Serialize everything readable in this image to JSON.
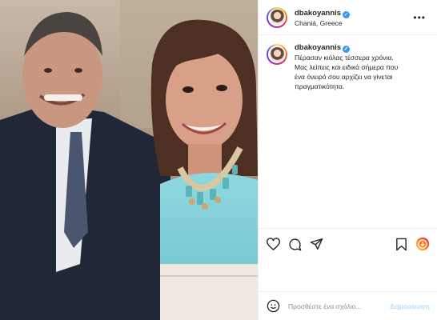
{
  "post": {
    "author": {
      "username": "dbakoyannis",
      "verified": true,
      "location": "Chaniá, Greece"
    },
    "caption": {
      "username": "dbakoyannis",
      "lines": [
        "Πέρασαν κιόλας τέσσερα χρόνια.",
        "Μας λείπεις και ειδικά σήμερα που",
        "ένα όνειρό σου αρχίζει να γίνεται",
        "πραγματικότητα."
      ]
    },
    "media": {
      "description_icon": "photo"
    },
    "actions": {
      "icons": [
        "heart-icon",
        "comment-icon",
        "share-icon",
        "bookmark-icon",
        "emoji-badge-icon"
      ]
    },
    "comment_box": {
      "placeholder": "Προσθέστε ένα σχόλιο...",
      "post_label": "Δημοσίευση"
    },
    "colors": {
      "link_blue": "#3897f0",
      "post_disabled": "#b2dffc",
      "border": "#efefef"
    }
  }
}
